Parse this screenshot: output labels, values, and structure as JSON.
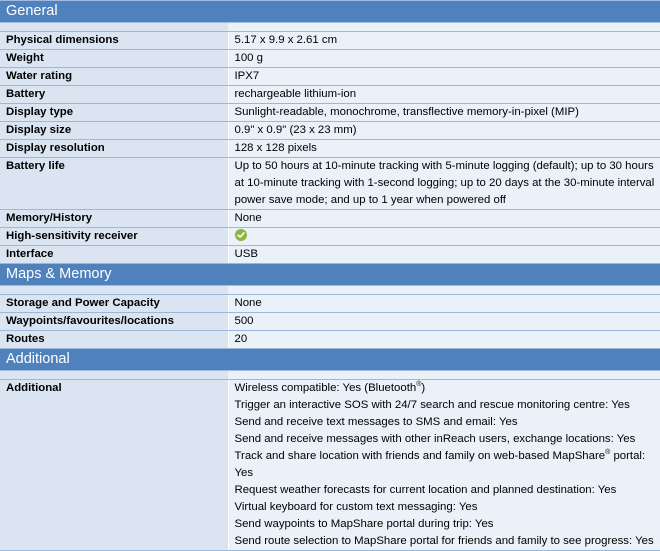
{
  "sections": [
    {
      "title": "General",
      "rows": [
        {
          "label": "Physical dimensions",
          "value": "5.17 x 9.9 x 2.61 cm"
        },
        {
          "label": "Weight",
          "value": "100 g"
        },
        {
          "label": "Water rating",
          "value": "IPX7"
        },
        {
          "label": "Battery",
          "value": "rechargeable lithium-ion"
        },
        {
          "label": "Display type",
          "value": "Sunlight-readable, monochrome, transflective memory-in-pixel (MIP)"
        },
        {
          "label": "Display size",
          "value": "0.9\" x 0.9\" (23 x 23 mm)"
        },
        {
          "label": "Display resolution",
          "value": "128 x 128 pixels"
        },
        {
          "label": "Battery life",
          "value": "Up to 50 hours at 10-minute tracking with 5-minute logging (default); up to 30 hours at 10-minute tracking with 1-second logging; up to 20 days at the 30-minute interval power save mode; and up to 1 year when powered off"
        },
        {
          "label": "Memory/History",
          "value": "None"
        },
        {
          "label": "High-sensitivity receiver",
          "value": "",
          "icon": "check-circle-icon",
          "icon_color": "#8db53a"
        },
        {
          "label": "Interface",
          "value": "USB"
        }
      ]
    },
    {
      "title": "Maps & Memory",
      "rows": [
        {
          "label": "Storage and Power Capacity",
          "value": "None"
        },
        {
          "label": "Waypoints/favourites/locations",
          "value": "500"
        },
        {
          "label": "Routes",
          "value": "20"
        }
      ]
    },
    {
      "title": "Additional",
      "rows": [
        {
          "label": "Additional",
          "lines": [
            {
              "text": "Wireless compatible: Yes (Bluetooth",
              "sup": "®",
              "after": ")"
            },
            {
              "text": "Trigger an interactive SOS with 24/7 search and rescue monitoring centre: Yes"
            },
            {
              "text": "Send and receive text messages to SMS and email: Yes"
            },
            {
              "text": "Send and receive messages with other inReach users, exchange locations: Yes"
            },
            {
              "text": "Track and share location with friends and family on web-based MapShare",
              "sup": "®",
              "after": " portal: Yes"
            },
            {
              "text": "Request weather forecasts for current location and planned destination: Yes"
            },
            {
              "text": "Virtual keyboard for custom text messaging: Yes"
            },
            {
              "text": "Send waypoints to MapShare portal during trip: Yes"
            },
            {
              "text": "Send route selection to MapShare portal for friends and family to see progress: Yes"
            }
          ]
        }
      ]
    }
  ]
}
